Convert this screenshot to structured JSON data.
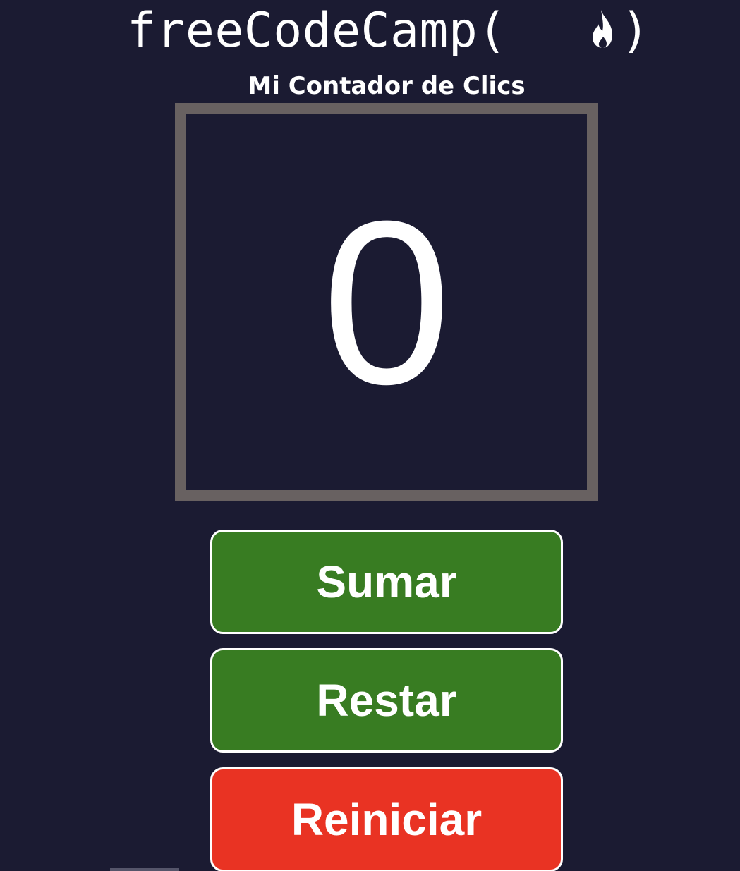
{
  "header": {
    "logo_text": "freeCodeCamp(",
    "logo_close": ")",
    "logo_icon": "fire-icon",
    "subtitle": "Mi Contador de Clics"
  },
  "counter": {
    "value": "0"
  },
  "buttons": {
    "add_label": "Sumar",
    "subtract_label": "Restar",
    "reset_label": "Reiniciar"
  },
  "colors": {
    "background": "#1b1b32",
    "counter_border": "#686161",
    "add_button": "#387c22",
    "subtract_button": "#387c22",
    "reset_button": "#e93323",
    "text": "#ffffff"
  }
}
